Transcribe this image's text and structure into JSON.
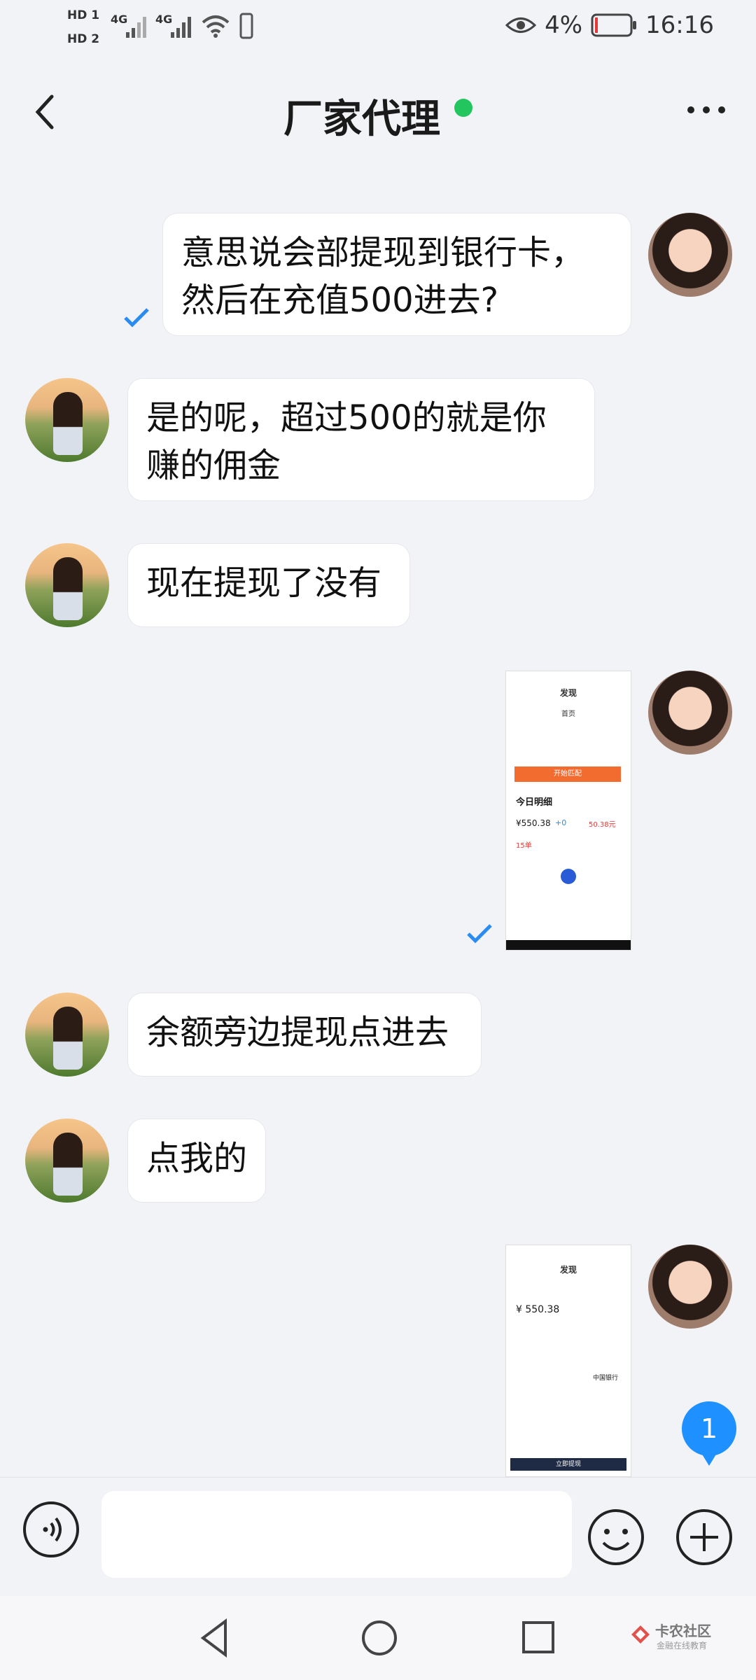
{
  "status_bar": {
    "sim1": "HD 1",
    "sim2": "HD 2",
    "net1": "4G",
    "net2": "4G",
    "battery": "4%",
    "time": "16:16"
  },
  "header": {
    "title": "厂家代理",
    "online_color": "#22c55e"
  },
  "messages": [
    {
      "side": "right",
      "text": "意思说会部提现到银行卡，然后在充值500进去?",
      "line1": "意思说会部提现到银行卡，",
      "line2": "然后在充值500进去?",
      "read": true
    },
    {
      "side": "left",
      "line1": "是的呢，超过500的就是你",
      "line2": "赚的佣金"
    },
    {
      "side": "left",
      "text": "现在提现了没有"
    },
    {
      "side": "right",
      "type": "image",
      "read": true,
      "image1": {
        "title": "发现",
        "tab": "首页",
        "button": "开始匹配",
        "section": "今日明细",
        "amount": "¥550.38",
        "plus": "+0",
        "red_amount": "50.38元",
        "count": "15单"
      }
    },
    {
      "side": "left",
      "text": "余额旁边提现点进去"
    },
    {
      "side": "left",
      "text": "点我的"
    },
    {
      "side": "right",
      "type": "image",
      "image2": {
        "title": "发现",
        "amount": "¥ 550.38",
        "button": "立即提现",
        "bank": "中国银行"
      }
    }
  ],
  "unread_badge": "1",
  "watermark": {
    "line1": "卡农社区",
    "line2": "金融在线教育"
  },
  "icons": {
    "back": "chevron-left-icon",
    "more": "more-dots-icon",
    "voice": "voice-icon",
    "emoji": "emoji-icon",
    "add": "plus-icon"
  }
}
